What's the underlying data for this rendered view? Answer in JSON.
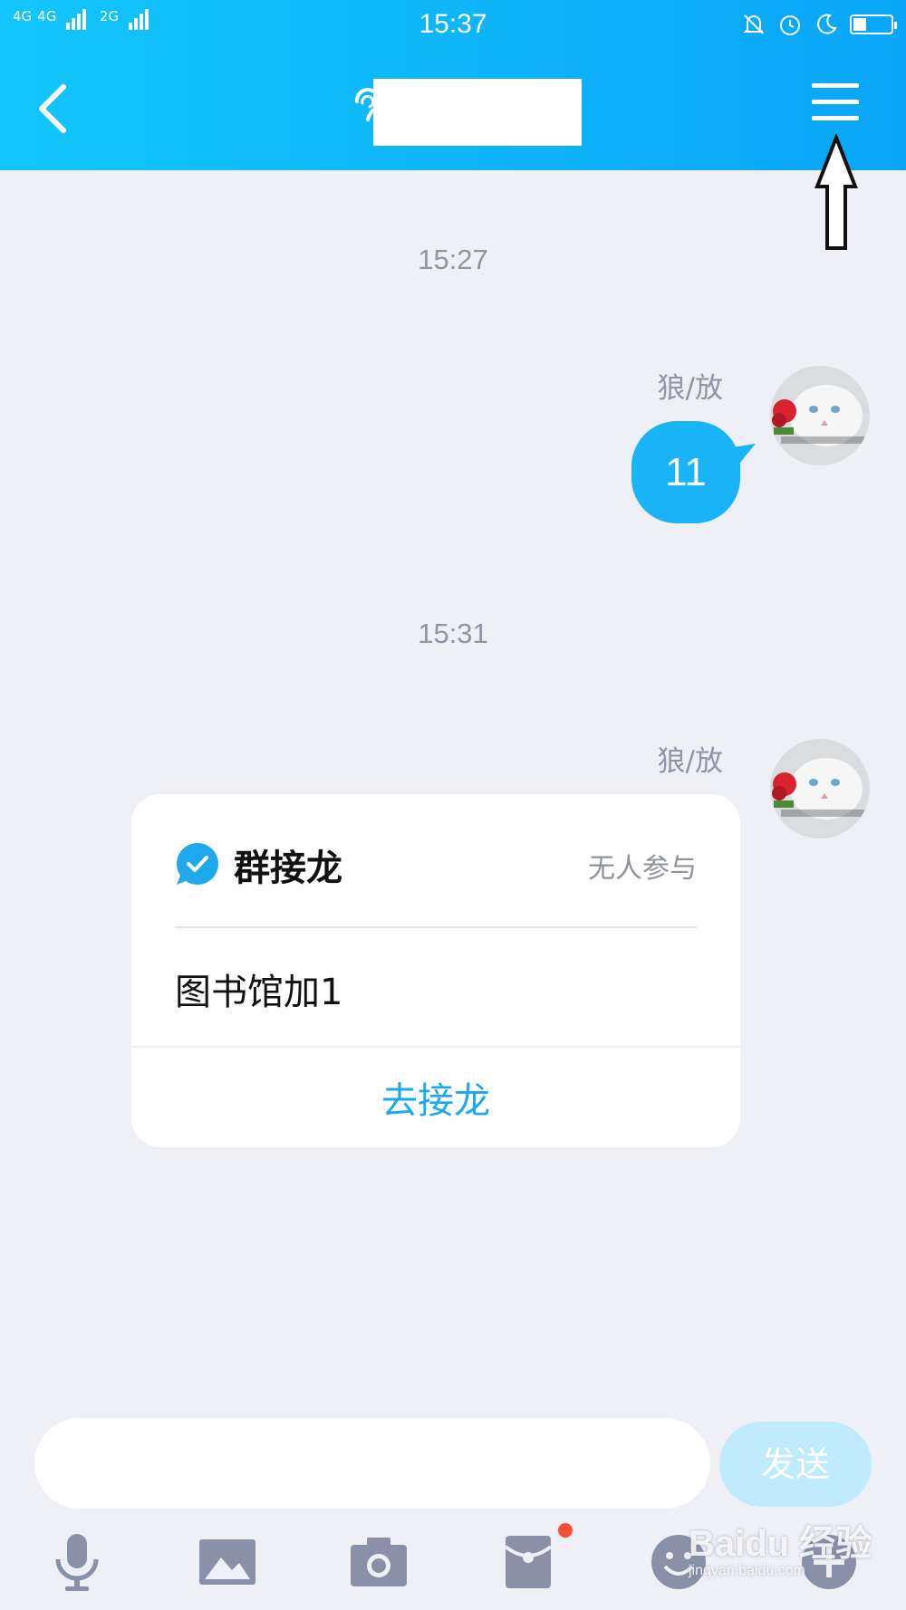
{
  "status_bar": {
    "network_1": "4G",
    "network_1b": "4G",
    "network_2": "2G",
    "time": "15:37",
    "battery_level": 0.35
  },
  "nav": {
    "back_icon": "chevron-left-icon",
    "menu_icon": "hamburger-menu-icon"
  },
  "messages": [
    {
      "timestamp": "15:27",
      "sender": "狼/放",
      "text": "11"
    },
    {
      "timestamp": "15:31",
      "sender": "狼/放"
    }
  ],
  "card": {
    "title": "群接龙",
    "status": "无人参与",
    "content": "图书馆加1",
    "action": "去接龙"
  },
  "input": {
    "value": "",
    "send_label": "发送"
  },
  "toolbar": {
    "icons": [
      "microphone-icon",
      "image-icon",
      "camera-icon",
      "red-packet-icon",
      "emoji-icon",
      "plus-icon"
    ]
  },
  "watermark": {
    "main": "Baidu 经验",
    "sub": "jingyan.baidu.com"
  },
  "colors": {
    "header_start": "#12c6fb",
    "header_end": "#0aa5f7",
    "bubble": "#18b4f6",
    "action": "#1aa8ee",
    "send_disabled": "#bfebfd",
    "background": "#eef0f6"
  }
}
